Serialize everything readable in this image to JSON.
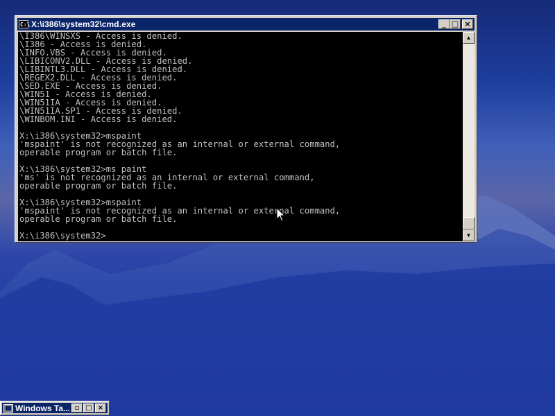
{
  "window": {
    "title": "X:\\i386\\system32\\cmd.exe",
    "icon_label": "C:\\",
    "buttons": {
      "minimize": "_",
      "maximize": "□",
      "close": "×"
    }
  },
  "console": {
    "lines": [
      "\\I386\\WINSXS - Access is denied.",
      "\\I386 - Access is denied.",
      "\\INFO.VBS - Access is denied.",
      "\\LIBICONV2.DLL - Access is denied.",
      "\\LIBINTL3.DLL - Access is denied.",
      "\\REGEX2.DLL - Access is denied.",
      "\\SED.EXE - Access is denied.",
      "\\WIN51 - Access is denied.",
      "\\WIN51IA - Access is denied.",
      "\\WIN51IA.SP1 - Access is denied.",
      "\\WINBOM.INI - Access is denied.",
      "",
      "X:\\i386\\system32>mspaint",
      "'mspaint' is not recognized as an internal or external command,",
      "operable program or batch file.",
      "",
      "X:\\i386\\system32>ms paint",
      "'ms' is not recognized as an internal or external command,",
      "operable program or batch file.",
      "",
      "X:\\i386\\system32>mspaint",
      "'mspaint' is not recognized as an internal or external command,",
      "operable program or batch file.",
      "",
      "X:\\i386\\system32>"
    ]
  },
  "scrollbar": {
    "up_arrow": "▲",
    "down_arrow": "▼"
  },
  "taskbar_item": {
    "label": "Windows Ta...",
    "buttons": {
      "restore": "▫",
      "maximize": "□",
      "close": "×"
    }
  },
  "colors": {
    "title_bar": "#0a246a",
    "console_bg": "#000000",
    "console_text": "#c0c0c0",
    "desktop_sky": "#1e3f9e"
  }
}
